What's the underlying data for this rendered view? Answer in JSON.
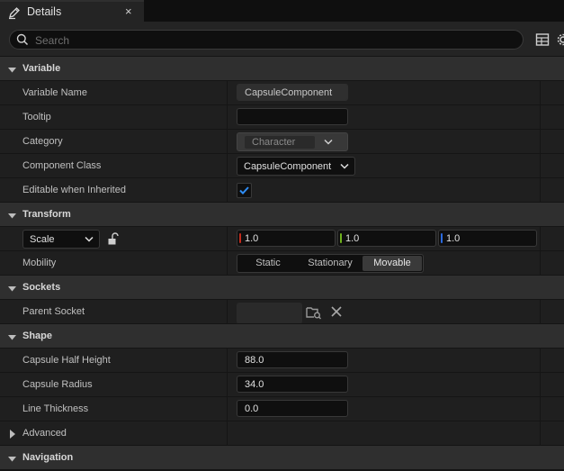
{
  "window": {
    "tab_title": "Details",
    "tab_icon": "pencil-icon",
    "close_glyph": "×"
  },
  "search": {
    "placeholder": "Search",
    "value": ""
  },
  "toolbar_icons": [
    "table-view-icon",
    "settings-gear-icon"
  ],
  "categories": {
    "variable": "Variable",
    "transform": "Transform",
    "sockets": "Sockets",
    "shape": "Shape",
    "advanced": "Advanced",
    "navigation": "Navigation"
  },
  "variable": {
    "name_label": "Variable Name",
    "name_value": "CapsuleComponent",
    "tooltip_label": "Tooltip",
    "tooltip_value": "",
    "category_label": "Category",
    "category_value": "Character",
    "component_class_label": "Component Class",
    "component_class_value": "CapsuleComponent",
    "editable_label": "Editable when Inherited",
    "editable_checked": true
  },
  "transform": {
    "scale_mode": "Scale",
    "scale_locked": false,
    "scale_x": "1.0",
    "scale_y": "1.0",
    "scale_z": "1.0",
    "mobility_label": "Mobility",
    "mobility_options": [
      "Static",
      "Stationary",
      "Movable"
    ],
    "mobility_selected": "Movable"
  },
  "sockets": {
    "parent_socket_label": "Parent Socket",
    "parent_socket_value": ""
  },
  "shape": {
    "half_height_label": "Capsule Half Height",
    "half_height_value": "88.0",
    "radius_label": "Capsule Radius",
    "radius_value": "34.0",
    "line_thickness_label": "Line Thickness",
    "line_thickness_value": "0.0"
  },
  "colors": {
    "axis_x": "#c42b1c",
    "axis_y": "#6fb21d",
    "axis_z": "#2b6be0",
    "checkmark": "#2f8df5"
  }
}
